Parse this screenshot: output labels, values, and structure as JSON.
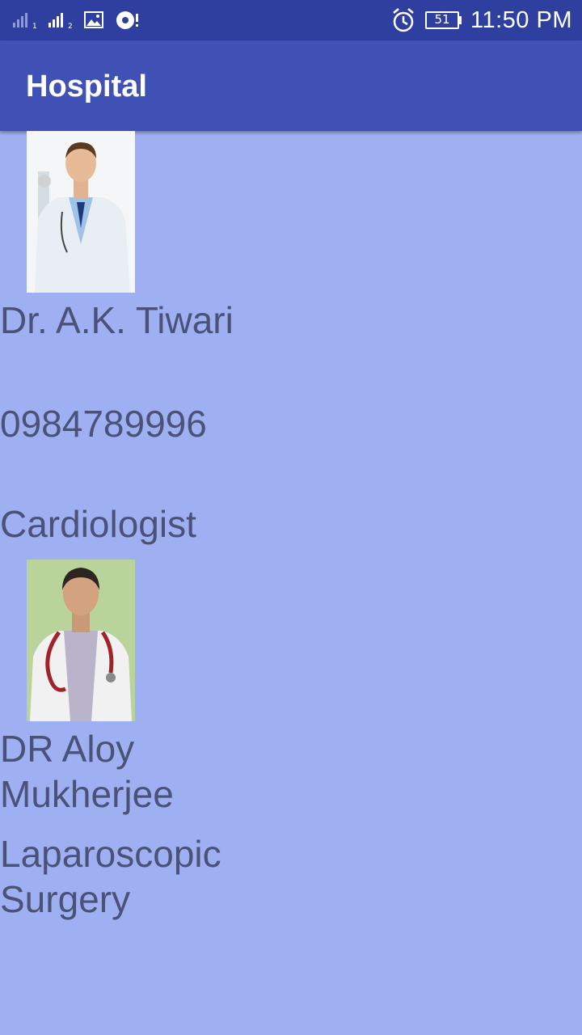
{
  "status_bar": {
    "time": "11:50 PM",
    "battery": "51",
    "icons": [
      "signal-sim1-icon",
      "signal-sim2-icon",
      "gallery-icon",
      "sync-icon",
      "alarm-icon",
      "battery-icon"
    ]
  },
  "app_bar": {
    "title": "Hospital"
  },
  "doctors": [
    {
      "photo": "doctor-photo",
      "name": "Dr. A.K. Tiwari",
      "phone": "0984789996",
      "specialty": "Cardiologist"
    },
    {
      "photo": "doctor-photo",
      "name_line1": "DR Aloy",
      "name_line2": "Mukherjee",
      "specialty_line1": "Laparoscopic",
      "specialty_line2": "Surgery"
    }
  ],
  "colors": {
    "status_bar": "#2f3f9f",
    "app_bar": "#3f51b5",
    "background": "#9fb0f2",
    "text": "#4a5277"
  }
}
